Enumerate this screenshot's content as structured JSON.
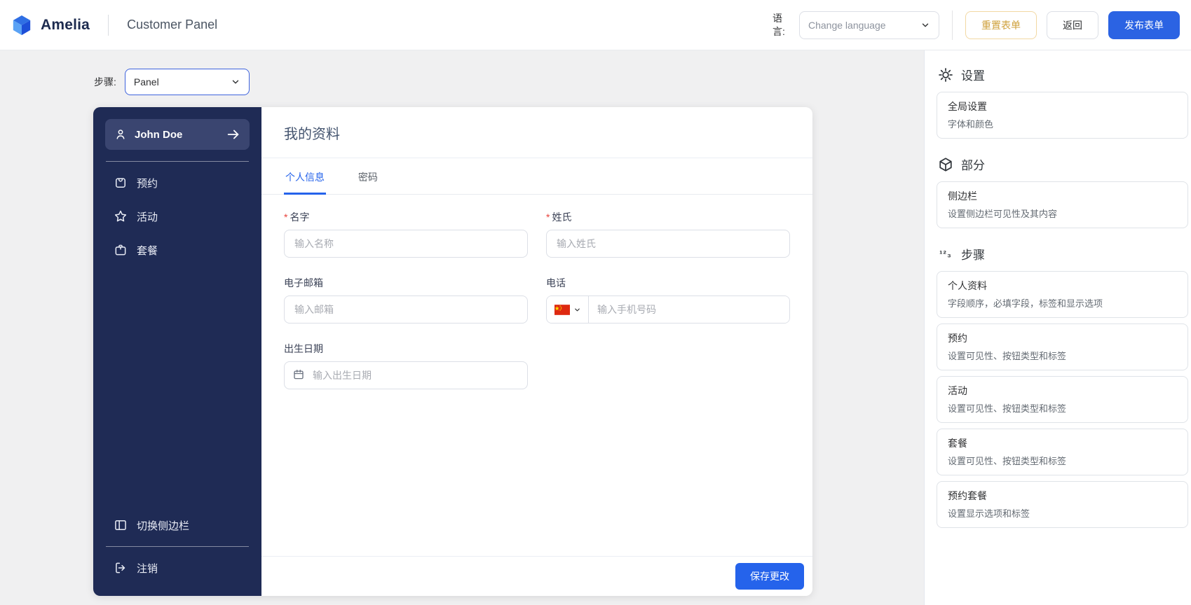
{
  "header": {
    "brand": "Amelia",
    "app_title": "Customer Panel",
    "language_label": "语言:",
    "language_select_value": "Change language",
    "reset_button": "重置表单",
    "back_button": "返回",
    "publish_button": "发布表单"
  },
  "toolbar": {
    "step_label": "步骤:",
    "step_select_value": "Panel"
  },
  "panel_sidebar": {
    "user_name": "John Doe",
    "items": [
      {
        "label": "预约",
        "icon": "appointments-icon"
      },
      {
        "label": "活动",
        "icon": "events-icon"
      },
      {
        "label": "套餐",
        "icon": "packages-icon"
      }
    ],
    "toggle_label": "切换侧边栏",
    "logout_label": "注销"
  },
  "profile": {
    "title": "我的资料",
    "required_marker": "*",
    "tabs": [
      {
        "label": "个人信息"
      },
      {
        "label": "密码"
      }
    ],
    "fields": {
      "first_name": {
        "label": "名字",
        "placeholder": "输入名称"
      },
      "last_name": {
        "label": "姓氏",
        "placeholder": "输入姓氏"
      },
      "email": {
        "label": "电子邮箱",
        "placeholder": "输入邮箱"
      },
      "phone": {
        "label": "电话",
        "placeholder": "输入手机号码",
        "flag": "china-flag-icon"
      },
      "birthday": {
        "label": "出生日期",
        "placeholder": "输入出生日期"
      }
    },
    "save_button": "保存更改"
  },
  "customize_panel": {
    "sections": [
      {
        "title": "设置",
        "icon": "gear-icon",
        "cards": [
          {
            "title": "全局设置",
            "subtitle": "字体和颜色"
          }
        ]
      },
      {
        "title": "部分",
        "icon": "cube-icon",
        "cards": [
          {
            "title": "侧边栏",
            "subtitle": "设置侧边栏可见性及其内容"
          }
        ]
      },
      {
        "title": "步骤",
        "icon": "steps-123-icon",
        "icon_text": "¹²₃",
        "cards": [
          {
            "title": "个人资料",
            "subtitle": "字段顺序，必填字段，标签和显示选项"
          },
          {
            "title": "预约",
            "subtitle": "设置可见性、按钮类型和标签"
          },
          {
            "title": "活动",
            "subtitle": "设置可见性、按钮类型和标签"
          },
          {
            "title": "套餐",
            "subtitle": "设置可见性、按钮类型和标签"
          },
          {
            "title": "预约套餐",
            "subtitle": "设置显示选项和标签"
          }
        ]
      }
    ]
  },
  "colors": {
    "accent_blue": "#2563eb",
    "publish_blue": "#2b63e3",
    "sidebar_navy": "#1f2b55",
    "sidebar_highlight": "#3a4570",
    "reset_gold": "#cfa13c",
    "required_red": "#e8423c",
    "flag_red": "#de2910"
  }
}
